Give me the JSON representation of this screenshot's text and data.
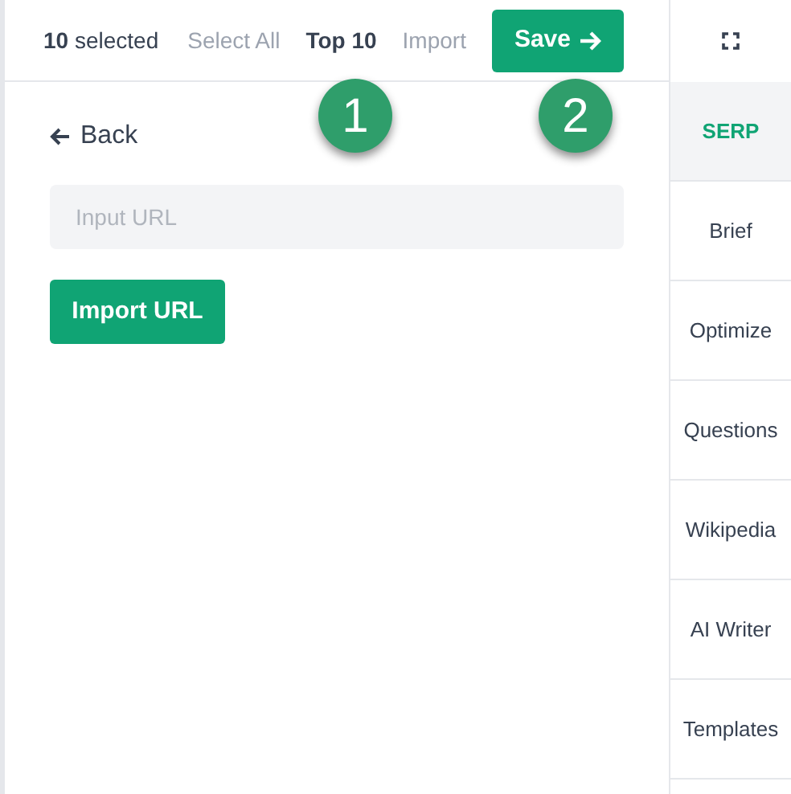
{
  "toolbar": {
    "count": "**10** selected",
    "tabs": [
      {
        "label": "Select All",
        "selected": false
      },
      {
        "label": "Top 10",
        "selected": true
      },
      {
        "label": "Import",
        "selected": false
      }
    ],
    "save_button": "Save"
  },
  "callouts": [
    "1",
    "2"
  ],
  "back_link": "Back",
  "url_field": {
    "placeholder": "Input URL"
  },
  "import_button": "Import URL",
  "sidebar": {
    "items": [
      {
        "label": "SERP",
        "selected": true
      },
      {
        "label": "Brief",
        "selected": false
      },
      {
        "label": "Optimize",
        "selected": false
      },
      {
        "label": "Questions",
        "selected": false
      },
      {
        "label": "Wikipedia",
        "selected": false
      },
      {
        "label": "AI Writer",
        "selected": false
      },
      {
        "label": "Templates",
        "selected": false
      }
    ]
  }
}
